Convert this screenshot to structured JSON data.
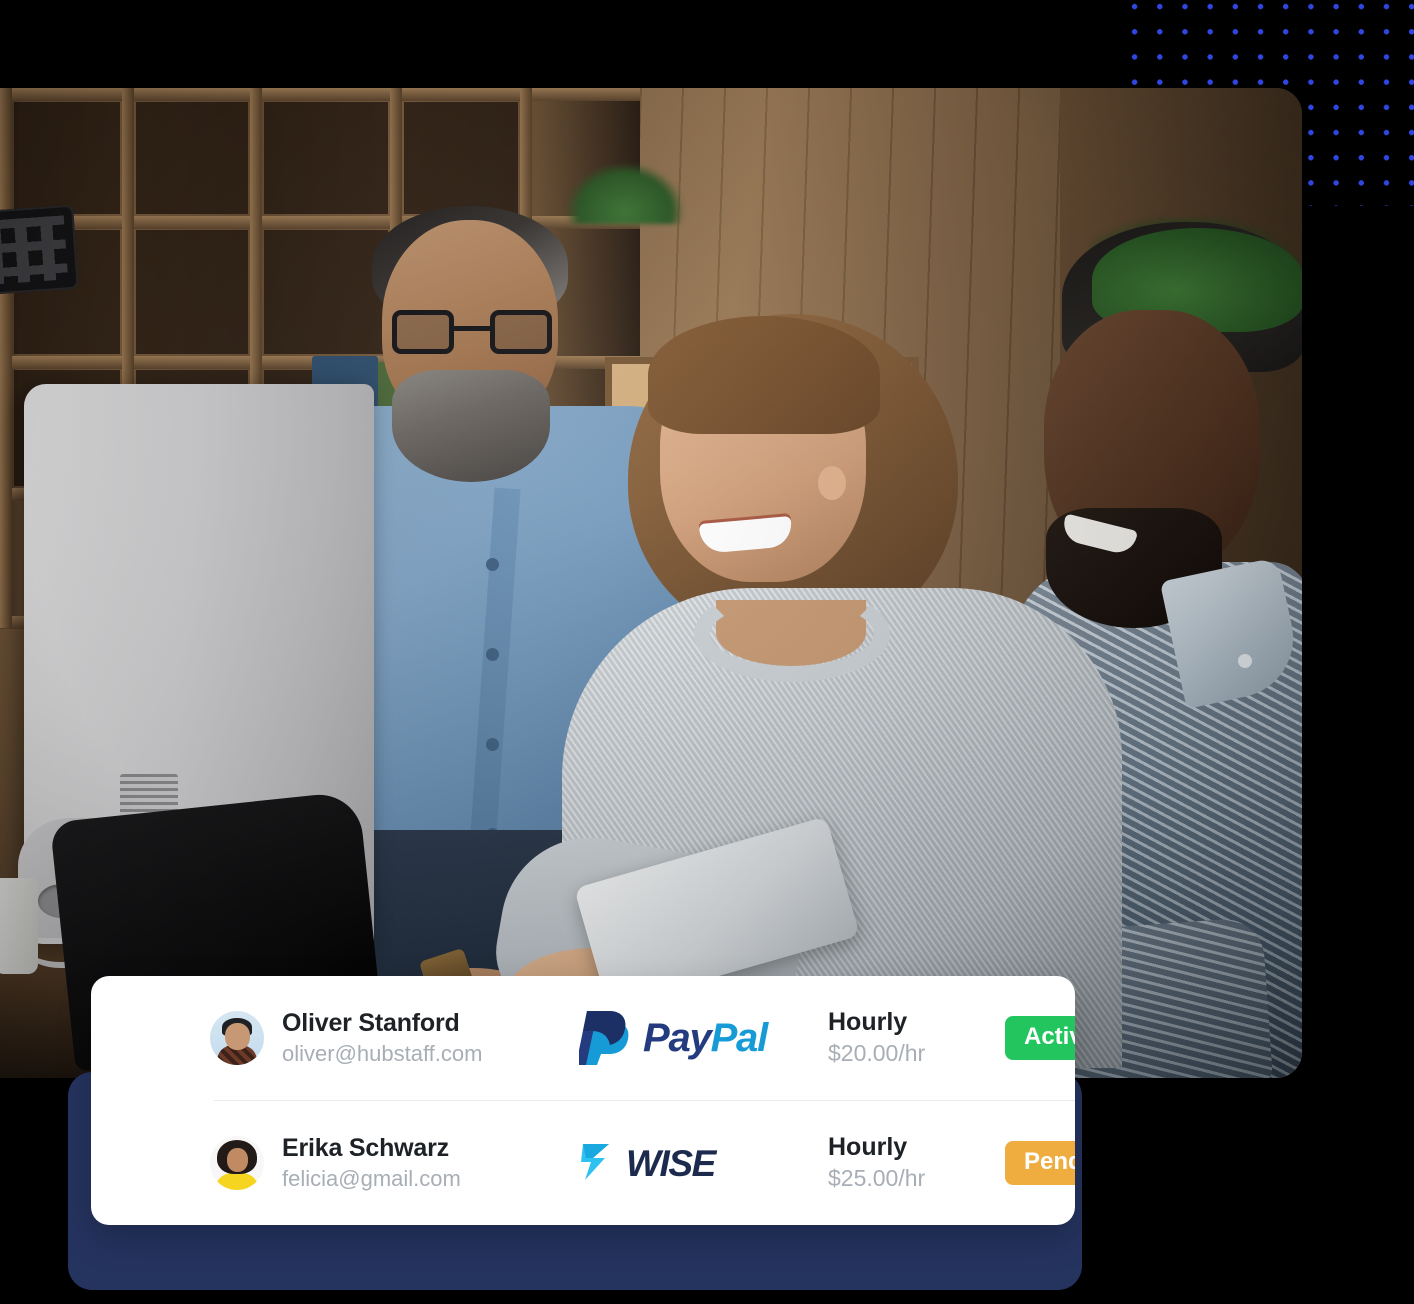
{
  "decor": {
    "dot_grid_color": "#2f46e0",
    "backing_panel_color": "#25335f"
  },
  "photo": {
    "alt": "Three colleagues smiling while looking at a desktop computer in an office",
    "people": [
      "man with glasses and grey beard in blue shirt",
      "woman in grey knit sweater holding a tablet",
      "man with green hat in patterned blue shirt"
    ]
  },
  "payments_card": {
    "rows": [
      {
        "avatar": "oliver-avatar",
        "name": "Oliver Stanford",
        "email": "oliver@hubstaff.com",
        "method": "paypal",
        "method_name": "PayPal",
        "method_part1": "Pay",
        "method_part2": "Pal",
        "rate_type": "Hourly",
        "rate_amount": "$20.00/hr",
        "status": "Active",
        "status_color": "#22c55e"
      },
      {
        "avatar": "erika-avatar",
        "name": "Erika Schwarz",
        "email": "felicia@gmail.com",
        "method": "wise",
        "method_name": "WISE",
        "method_part1": "WI",
        "method_part2": "SE",
        "rate_type": "Hourly",
        "rate_amount": "$25.00/hr",
        "status": "Pending",
        "status_color": "#efad3f"
      }
    ]
  }
}
